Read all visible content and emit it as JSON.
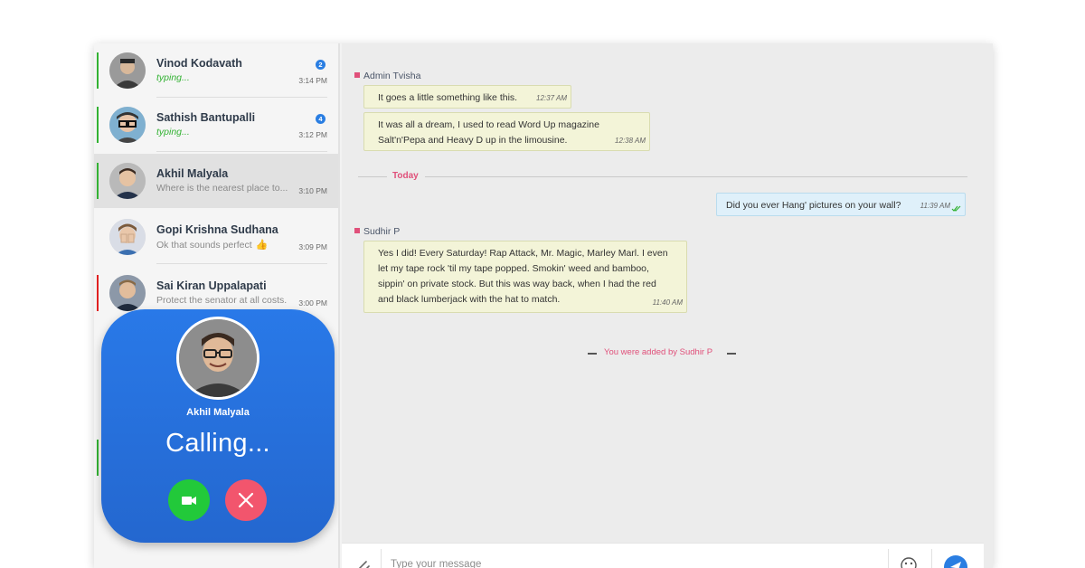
{
  "contacts": [
    {
      "name": "Vinod Kodavath",
      "preview": "typing...",
      "time": "3:14 PM",
      "badge": "2",
      "status_color": "#33b233"
    },
    {
      "name": "Sathish Bantupalli",
      "preview": "typing...",
      "time": "3:12 PM",
      "badge": "4",
      "status_color": "#33b233"
    },
    {
      "name": "Akhil Malyala",
      "preview": "Where is the nearest place to...",
      "time": "3:10 PM",
      "status_color": "#33b233"
    },
    {
      "name": "Gopi Krishna Sudhana",
      "preview": "Ok that sounds perfect",
      "time": "3:09 PM",
      "emoji": "👍",
      "status_color": ""
    },
    {
      "name": "Sai Kiran Uppalapati",
      "preview": "Protect the senator at all costs.",
      "time": "3:00 PM",
      "status_color": "#e02020"
    }
  ],
  "call": {
    "name": "Akhil Malyala",
    "status": "Calling..."
  },
  "chat": {
    "group1_sender": "Admin Tvisha",
    "m1": {
      "text": "It goes a little something like this.",
      "time": "12:37 AM"
    },
    "m2": {
      "line1": "It was all a dream, I used to read Word Up magazine",
      "line2": "Salt'n'Pepa and Heavy D up in the limousine.",
      "time": "12:38 AM"
    },
    "day_label": "Today",
    "m3": {
      "text": "Did you ever Hang' pictures on your wall?",
      "time": "11:39 AM"
    },
    "group2_sender": "Sudhir P",
    "m4": {
      "line1": "Yes I did! Every Saturday! Rap Attack, Mr. Magic, Marley Marl. I even",
      "line2": "let my tape rock 'til my tape popped. Smokin' weed and bamboo,",
      "line3": "sippin' on private stock.  But this was way back, when I had the red",
      "line4": "and black lumberjack with the hat to match.",
      "time": "11:40 AM"
    },
    "system_message": "You were added by Sudhir P"
  },
  "composer": {
    "placeholder": "Type your message"
  },
  "colors": {
    "accent": "#2a7ee2",
    "pink": "#e0507a",
    "online": "#33b233",
    "call_blue": "#2979e8",
    "accept": "#22c93a",
    "decline": "#f2556d"
  },
  "icons": [
    "attach-icon",
    "emoji-icon",
    "send-icon",
    "video-call-icon",
    "close-icon",
    "double-check-icon"
  ]
}
